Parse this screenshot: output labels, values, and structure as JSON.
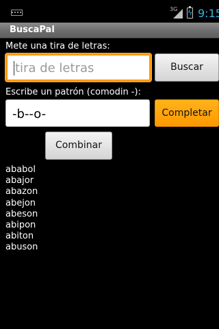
{
  "status_bar": {
    "keyboard_icon": "keyboard-icon",
    "network_label": "3G",
    "signal_icon": "signal-icon",
    "battery_icon": "battery-charging-icon",
    "time": "9:15",
    "accent_color": "#33b5e5"
  },
  "app": {
    "title": "BuscaPal"
  },
  "form": {
    "letters_label": "Mete una tira de letras:",
    "letters_value": "",
    "letters_placeholder": "tira de letras",
    "search_button": "Buscar",
    "pattern_label": "Escribe un patrón (comodin -):",
    "pattern_value": "-b--o-",
    "complete_button": "Completar",
    "combine_button": "Combinar",
    "focus_color": "#ff9900"
  },
  "results": [
    "ababol",
    "abajor",
    "abazon",
    "abejon",
    "abeson",
    "abipon",
    "abiton",
    "abuson"
  ]
}
